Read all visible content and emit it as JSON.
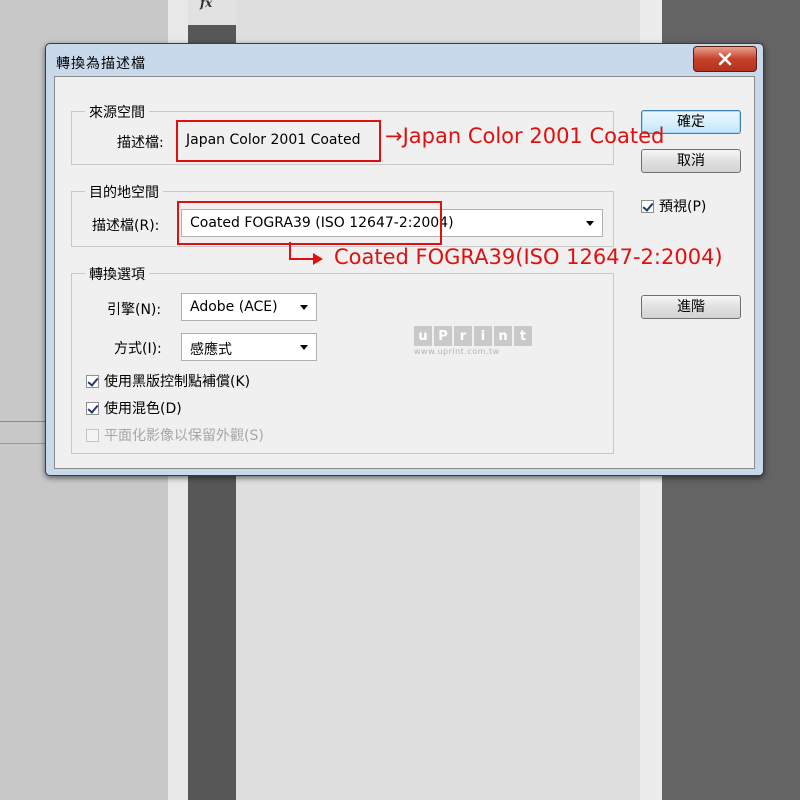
{
  "background": {
    "fx_label": "fx"
  },
  "dialog": {
    "title": "轉換為描述檔",
    "source_space": {
      "group_label": "來源空間",
      "profile_label": "描述檔:",
      "profile_value": "Japan Color 2001 Coated"
    },
    "destination_space": {
      "group_label": "目的地空間",
      "profile_label": "描述檔(R):",
      "profile_value": "Coated FOGRA39 (ISO 12647-2:2004)"
    },
    "conversion_options": {
      "group_label": "轉換選項",
      "engine_label": "引擎(N):",
      "engine_value": "Adobe (ACE)",
      "intent_label": "方式(I):",
      "intent_value": "感應式",
      "black_point_label": "使用黑版控制點補償(K)",
      "black_point_checked": true,
      "dither_label": "使用混色(D)",
      "dither_checked": true,
      "flatten_label": "平面化影像以保留外觀(S)",
      "flatten_checked": false,
      "flatten_enabled": false
    },
    "buttons": {
      "ok": "確定",
      "cancel": "取消",
      "advanced": "進階"
    },
    "preview": {
      "label": "預視(P)",
      "checked": true
    }
  },
  "watermark": {
    "letters": [
      "u",
      "P",
      "r",
      "i",
      "n",
      "t"
    ],
    "url": "www.uprint.com.tw"
  },
  "annotations": {
    "source_note": "→Japan Color 2001 Coated",
    "dest_note": "Coated FOGRA39(ISO 12647-2:2004)",
    "color": "#e01010"
  }
}
